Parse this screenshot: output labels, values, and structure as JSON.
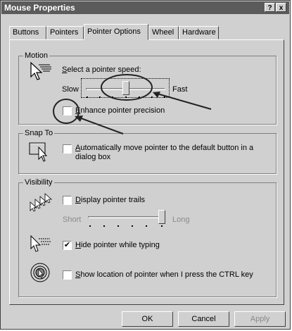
{
  "window": {
    "title": "Mouse Properties",
    "help_glyph": "?",
    "close_glyph": "x"
  },
  "tabs": [
    {
      "label": "Buttons",
      "active": false
    },
    {
      "label": "Pointers",
      "active": false
    },
    {
      "label": "Pointer Options",
      "active": true
    },
    {
      "label": "Wheel",
      "active": false
    },
    {
      "label": "Hardware",
      "active": false
    }
  ],
  "motion": {
    "legend": "Motion",
    "prompt": "Select a pointer speed:",
    "slow_label": "Slow",
    "fast_label": "Fast",
    "speed_level": 0.5,
    "enhance_label": "Enhance pointer precision",
    "enhance_checked": false
  },
  "snap_to": {
    "legend": "Snap To",
    "label_line1": "Automatically move pointer to the default button in a",
    "label_line2": "dialog box",
    "checked": false
  },
  "visibility": {
    "legend": "Visibility",
    "trails_label": "Display pointer trails",
    "trails_checked": false,
    "short_label": "Short",
    "long_label": "Long",
    "trail_length": 1.0,
    "hide_label": "Hide pointer while typing",
    "hide_checked": true,
    "show_location_label": "Show location of pointer when I press the CTRL key",
    "show_location_checked": false
  },
  "buttons": {
    "ok": "OK",
    "cancel": "Cancel",
    "apply": "Apply"
  },
  "icons": [
    "pointer-speed-icon",
    "snap-to-icon",
    "pointer-trails-icon",
    "hide-pointer-icon",
    "show-location-icon"
  ]
}
